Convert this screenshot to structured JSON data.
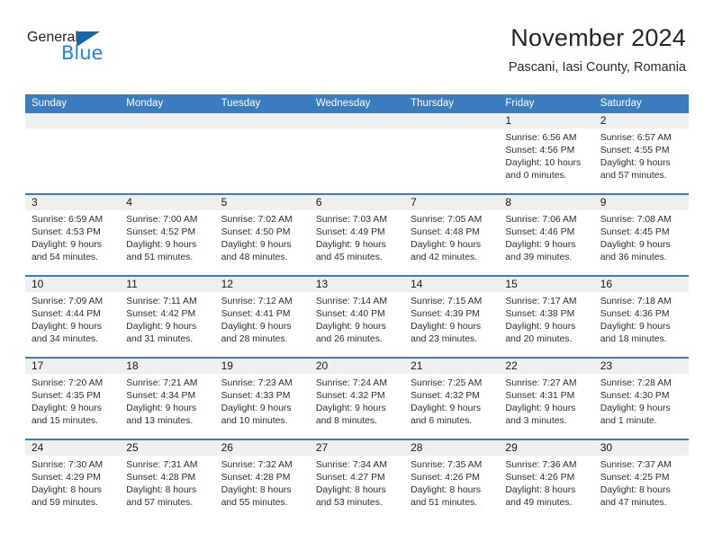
{
  "brand": {
    "name_top": "General",
    "name_bottom": "Blue",
    "triangle_color": "#1269b0",
    "blue_color": "#1e88d2"
  },
  "header": {
    "title": "November 2024",
    "subtitle": "Pascani, Iasi County, Romania"
  },
  "theme": {
    "header_blue": "#3a7cbe",
    "daynum_band": "#efefef",
    "text": "#2e2e2e"
  },
  "weekday_headers": [
    "Sunday",
    "Monday",
    "Tuesday",
    "Wednesday",
    "Thursday",
    "Friday",
    "Saturday"
  ],
  "labels": {
    "sunrise_prefix": "Sunrise:",
    "sunset_prefix": "Sunset:",
    "daylight_prefix": "Daylight:"
  },
  "weeks": [
    [
      {
        "day": "",
        "sunrise": "",
        "sunset": "",
        "daylight_line1": "",
        "daylight_line2": "",
        "empty": true
      },
      {
        "day": "",
        "sunrise": "",
        "sunset": "",
        "daylight_line1": "",
        "daylight_line2": "",
        "empty": true
      },
      {
        "day": "",
        "sunrise": "",
        "sunset": "",
        "daylight_line1": "",
        "daylight_line2": "",
        "empty": true
      },
      {
        "day": "",
        "sunrise": "",
        "sunset": "",
        "daylight_line1": "",
        "daylight_line2": "",
        "empty": true
      },
      {
        "day": "",
        "sunrise": "",
        "sunset": "",
        "daylight_line1": "",
        "daylight_line2": "",
        "empty": true
      },
      {
        "day": "1",
        "sunrise": "Sunrise: 6:56 AM",
        "sunset": "Sunset: 4:56 PM",
        "daylight_line1": "Daylight: 10 hours",
        "daylight_line2": "and 0 minutes."
      },
      {
        "day": "2",
        "sunrise": "Sunrise: 6:57 AM",
        "sunset": "Sunset: 4:55 PM",
        "daylight_line1": "Daylight: 9 hours",
        "daylight_line2": "and 57 minutes."
      }
    ],
    [
      {
        "day": "3",
        "sunrise": "Sunrise: 6:59 AM",
        "sunset": "Sunset: 4:53 PM",
        "daylight_line1": "Daylight: 9 hours",
        "daylight_line2": "and 54 minutes."
      },
      {
        "day": "4",
        "sunrise": "Sunrise: 7:00 AM",
        "sunset": "Sunset: 4:52 PM",
        "daylight_line1": "Daylight: 9 hours",
        "daylight_line2": "and 51 minutes."
      },
      {
        "day": "5",
        "sunrise": "Sunrise: 7:02 AM",
        "sunset": "Sunset: 4:50 PM",
        "daylight_line1": "Daylight: 9 hours",
        "daylight_line2": "and 48 minutes."
      },
      {
        "day": "6",
        "sunrise": "Sunrise: 7:03 AM",
        "sunset": "Sunset: 4:49 PM",
        "daylight_line1": "Daylight: 9 hours",
        "daylight_line2": "and 45 minutes."
      },
      {
        "day": "7",
        "sunrise": "Sunrise: 7:05 AM",
        "sunset": "Sunset: 4:48 PM",
        "daylight_line1": "Daylight: 9 hours",
        "daylight_line2": "and 42 minutes."
      },
      {
        "day": "8",
        "sunrise": "Sunrise: 7:06 AM",
        "sunset": "Sunset: 4:46 PM",
        "daylight_line1": "Daylight: 9 hours",
        "daylight_line2": "and 39 minutes."
      },
      {
        "day": "9",
        "sunrise": "Sunrise: 7:08 AM",
        "sunset": "Sunset: 4:45 PM",
        "daylight_line1": "Daylight: 9 hours",
        "daylight_line2": "and 36 minutes."
      }
    ],
    [
      {
        "day": "10",
        "sunrise": "Sunrise: 7:09 AM",
        "sunset": "Sunset: 4:44 PM",
        "daylight_line1": "Daylight: 9 hours",
        "daylight_line2": "and 34 minutes."
      },
      {
        "day": "11",
        "sunrise": "Sunrise: 7:11 AM",
        "sunset": "Sunset: 4:42 PM",
        "daylight_line1": "Daylight: 9 hours",
        "daylight_line2": "and 31 minutes."
      },
      {
        "day": "12",
        "sunrise": "Sunrise: 7:12 AM",
        "sunset": "Sunset: 4:41 PM",
        "daylight_line1": "Daylight: 9 hours",
        "daylight_line2": "and 28 minutes."
      },
      {
        "day": "13",
        "sunrise": "Sunrise: 7:14 AM",
        "sunset": "Sunset: 4:40 PM",
        "daylight_line1": "Daylight: 9 hours",
        "daylight_line2": "and 26 minutes."
      },
      {
        "day": "14",
        "sunrise": "Sunrise: 7:15 AM",
        "sunset": "Sunset: 4:39 PM",
        "daylight_line1": "Daylight: 9 hours",
        "daylight_line2": "and 23 minutes."
      },
      {
        "day": "15",
        "sunrise": "Sunrise: 7:17 AM",
        "sunset": "Sunset: 4:38 PM",
        "daylight_line1": "Daylight: 9 hours",
        "daylight_line2": "and 20 minutes."
      },
      {
        "day": "16",
        "sunrise": "Sunrise: 7:18 AM",
        "sunset": "Sunset: 4:36 PM",
        "daylight_line1": "Daylight: 9 hours",
        "daylight_line2": "and 18 minutes."
      }
    ],
    [
      {
        "day": "17",
        "sunrise": "Sunrise: 7:20 AM",
        "sunset": "Sunset: 4:35 PM",
        "daylight_line1": "Daylight: 9 hours",
        "daylight_line2": "and 15 minutes."
      },
      {
        "day": "18",
        "sunrise": "Sunrise: 7:21 AM",
        "sunset": "Sunset: 4:34 PM",
        "daylight_line1": "Daylight: 9 hours",
        "daylight_line2": "and 13 minutes."
      },
      {
        "day": "19",
        "sunrise": "Sunrise: 7:23 AM",
        "sunset": "Sunset: 4:33 PM",
        "daylight_line1": "Daylight: 9 hours",
        "daylight_line2": "and 10 minutes."
      },
      {
        "day": "20",
        "sunrise": "Sunrise: 7:24 AM",
        "sunset": "Sunset: 4:32 PM",
        "daylight_line1": "Daylight: 9 hours",
        "daylight_line2": "and 8 minutes."
      },
      {
        "day": "21",
        "sunrise": "Sunrise: 7:25 AM",
        "sunset": "Sunset: 4:32 PM",
        "daylight_line1": "Daylight: 9 hours",
        "daylight_line2": "and 6 minutes."
      },
      {
        "day": "22",
        "sunrise": "Sunrise: 7:27 AM",
        "sunset": "Sunset: 4:31 PM",
        "daylight_line1": "Daylight: 9 hours",
        "daylight_line2": "and 3 minutes."
      },
      {
        "day": "23",
        "sunrise": "Sunrise: 7:28 AM",
        "sunset": "Sunset: 4:30 PM",
        "daylight_line1": "Daylight: 9 hours",
        "daylight_line2": "and 1 minute."
      }
    ],
    [
      {
        "day": "24",
        "sunrise": "Sunrise: 7:30 AM",
        "sunset": "Sunset: 4:29 PM",
        "daylight_line1": "Daylight: 8 hours",
        "daylight_line2": "and 59 minutes."
      },
      {
        "day": "25",
        "sunrise": "Sunrise: 7:31 AM",
        "sunset": "Sunset: 4:28 PM",
        "daylight_line1": "Daylight: 8 hours",
        "daylight_line2": "and 57 minutes."
      },
      {
        "day": "26",
        "sunrise": "Sunrise: 7:32 AM",
        "sunset": "Sunset: 4:28 PM",
        "daylight_line1": "Daylight: 8 hours",
        "daylight_line2": "and 55 minutes."
      },
      {
        "day": "27",
        "sunrise": "Sunrise: 7:34 AM",
        "sunset": "Sunset: 4:27 PM",
        "daylight_line1": "Daylight: 8 hours",
        "daylight_line2": "and 53 minutes."
      },
      {
        "day": "28",
        "sunrise": "Sunrise: 7:35 AM",
        "sunset": "Sunset: 4:26 PM",
        "daylight_line1": "Daylight: 8 hours",
        "daylight_line2": "and 51 minutes."
      },
      {
        "day": "29",
        "sunrise": "Sunrise: 7:36 AM",
        "sunset": "Sunset: 4:26 PM",
        "daylight_line1": "Daylight: 8 hours",
        "daylight_line2": "and 49 minutes."
      },
      {
        "day": "30",
        "sunrise": "Sunrise: 7:37 AM",
        "sunset": "Sunset: 4:25 PM",
        "daylight_line1": "Daylight: 8 hours",
        "daylight_line2": "and 47 minutes."
      }
    ]
  ]
}
